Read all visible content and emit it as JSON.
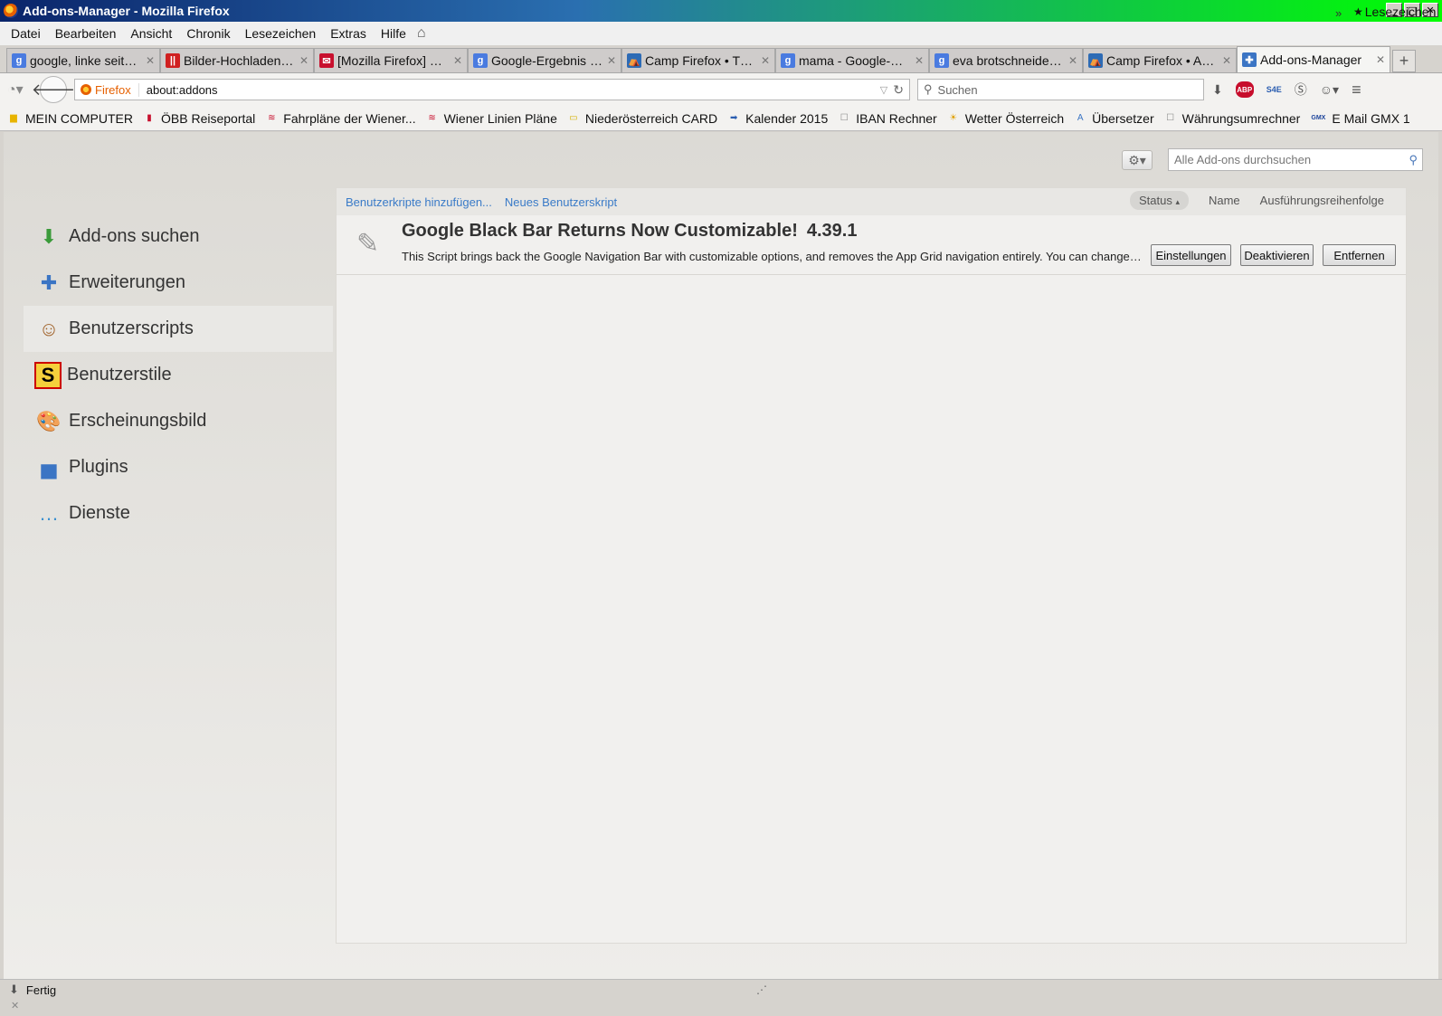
{
  "window": {
    "title": "Add-ons-Manager - Mozilla Firefox",
    "title_gradient": [
      "#0a246a",
      "#00ff00"
    ],
    "controls": [
      "_",
      "□",
      "✕"
    ]
  },
  "menubar": {
    "items": [
      "Datei",
      "Bearbeiten",
      "Ansicht",
      "Chronik",
      "Lesezeichen",
      "Extras",
      "Hilfe"
    ]
  },
  "tabs": [
    {
      "label": "google, linke seite, f...",
      "icon": "google-icon",
      "color": "#4a7be0",
      "glyph": "g"
    },
    {
      "label": "Bilder-Hochladen.net",
      "icon": "bilder-icon",
      "color": "#d02020",
      "glyph": "||"
    },
    {
      "label": "[Mozilla Firefox] Fir...",
      "icon": "camp-firefox-icon",
      "color": "#c8102e",
      "glyph": "✉"
    },
    {
      "label": "Google-Ergebnis für...",
      "icon": "google-icon",
      "color": "#4a7be0",
      "glyph": "g"
    },
    {
      "label": "Camp Firefox • The...",
      "icon": "camp-icon",
      "color": "#2d6bb5",
      "glyph": "⛺"
    },
    {
      "label": "mama - Google-Suc...",
      "icon": "google-icon",
      "color": "#4a7be0",
      "glyph": "g"
    },
    {
      "label": "eva brotschneidema...",
      "icon": "google-icon",
      "color": "#4a7be0",
      "glyph": "g"
    },
    {
      "label": "Camp Firefox • Ant...",
      "icon": "camp-icon",
      "color": "#2d6bb5",
      "glyph": "⛺"
    },
    {
      "label": "Add-ons-Manager",
      "icon": "puzzle-icon",
      "color": "#3b75c4",
      "glyph": "✚",
      "active": true
    }
  ],
  "navbar": {
    "identity": "Firefox",
    "url": "about:addons",
    "search_placeholder": "Suchen",
    "abp_label": "ABP",
    "s4e_label": "S4E"
  },
  "bookmarks": [
    {
      "label": "MEIN COMPUTER",
      "icon": "folder-icon",
      "color": "#e8b400"
    },
    {
      "label": "ÖBB Reiseportal",
      "icon": "oebb-icon",
      "color": "#c8102e"
    },
    {
      "label": "Fahrpläne der Wiener...",
      "icon": "wienerlinien-icon",
      "color": "#c8102e"
    },
    {
      "label": "Wiener Linien Pläne",
      "icon": "wienerlinien-icon",
      "color": "#c8102e"
    },
    {
      "label": "Niederösterreich CARD",
      "icon": "card-icon",
      "color": "#d4b000"
    },
    {
      "label": "Kalender 2015",
      "icon": "arrow-icon",
      "color": "#2a5db0"
    },
    {
      "label": "IBAN Rechner",
      "icon": "page-icon",
      "color": "#888888"
    },
    {
      "label": "Wetter Österreich",
      "icon": "weather-icon",
      "color": "#e0a000"
    },
    {
      "label": "Übersetzer",
      "icon": "translate-icon",
      "color": "#3b75c4"
    },
    {
      "label": "Währungsumrechner",
      "icon": "page-icon",
      "color": "#888888"
    },
    {
      "label": "E Mail GMX 1",
      "icon": "gmx-icon",
      "color": "#1c449b",
      "glyph": "GMX"
    }
  ],
  "bookmarks_overflow": "»",
  "bookmarks_menu": "Lesezeichen",
  "addons": {
    "search_placeholder": "Alle Add-ons durchsuchen",
    "categories": [
      {
        "label": "Add-ons suchen",
        "icon": "download-icon"
      },
      {
        "label": "Erweiterungen",
        "icon": "puzzle-icon"
      },
      {
        "label": "Benutzerscripts",
        "icon": "greasemonkey-icon",
        "selected": true
      },
      {
        "label": "Benutzerstile",
        "icon": "stylish-icon"
      },
      {
        "label": "Erscheinungsbild",
        "icon": "palette-icon"
      },
      {
        "label": "Plugins",
        "icon": "plugin-icon"
      },
      {
        "label": "Dienste",
        "icon": "chat-icon"
      }
    ],
    "header_links": [
      "Benutzerkripte hinzufügen...",
      "Neues Benutzerskript"
    ],
    "sorters": {
      "status": "Status",
      "name": "Name",
      "order": "Ausführungsreihenfolge"
    },
    "items": [
      {
        "name": "Google Black Bar Returns Now Customizable!",
        "version": "4.39.1",
        "description": "This Script brings back the Google Navigation Bar with customizable options, and removes the App Grid navigation entirely. You can change th...",
        "buttons": {
          "settings": "Einstellungen",
          "disable": "Deaktivieren",
          "remove": "Entfernen"
        }
      }
    ]
  },
  "statusbar": {
    "text": "Fertig"
  }
}
